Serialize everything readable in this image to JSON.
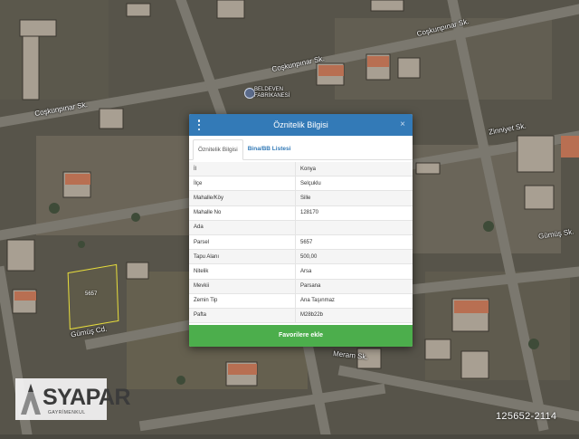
{
  "map": {
    "streets": [
      {
        "label": "Coşkunpınar Sk."
      },
      {
        "label": "Coşkunpınar Sk."
      },
      {
        "label": "Coşkunpınar Sk."
      },
      {
        "label": "Zinniyet Sk."
      },
      {
        "label": "Gümüş Sk."
      },
      {
        "label": "Gümüş Cd."
      },
      {
        "label": "Meram Sk."
      }
    ],
    "poi": {
      "label_line1": "BELDEVEN",
      "label_line2": "FABRİKANESİ",
      "icon": "map-pin-icon"
    },
    "parcel_tag": "5657"
  },
  "dialog": {
    "title": "Öznitelik Bilgisi",
    "menu_icon": "vertical-dots-icon",
    "close_label": "×",
    "tabs": [
      {
        "label": "Öznitelik Bilgisi",
        "active": true
      },
      {
        "label": "Bina/BB Listesi",
        "active": false
      }
    ],
    "rows": [
      {
        "key": "İl",
        "value": "Konya"
      },
      {
        "key": "İlçe",
        "value": "Selçuklu"
      },
      {
        "key": "Mahalle/Köy",
        "value": "Sille"
      },
      {
        "key": "Mahalle No",
        "value": "128170"
      },
      {
        "key": "Ada",
        "value": ""
      },
      {
        "key": "Parsel",
        "value": "5657"
      },
      {
        "key": "Tapu Alanı",
        "value": "500,00"
      },
      {
        "key": "Nitelik",
        "value": "Arsa"
      },
      {
        "key": "Mevkii",
        "value": "Parsana"
      },
      {
        "key": "Zemin Tip",
        "value": "Ana Taşınmaz"
      },
      {
        "key": "Pafta",
        "value": "M28b22b"
      }
    ],
    "favorite_button_label": "Favorilere ekle"
  },
  "watermark": {
    "brand": "SYAPAR",
    "tagline": "GAYRİMENKUL"
  },
  "listing_id": "125652-2114",
  "colors": {
    "header_blue": "#337ab7",
    "button_green": "#4cae4c",
    "parcel_yellow": "#e6dc3c"
  }
}
